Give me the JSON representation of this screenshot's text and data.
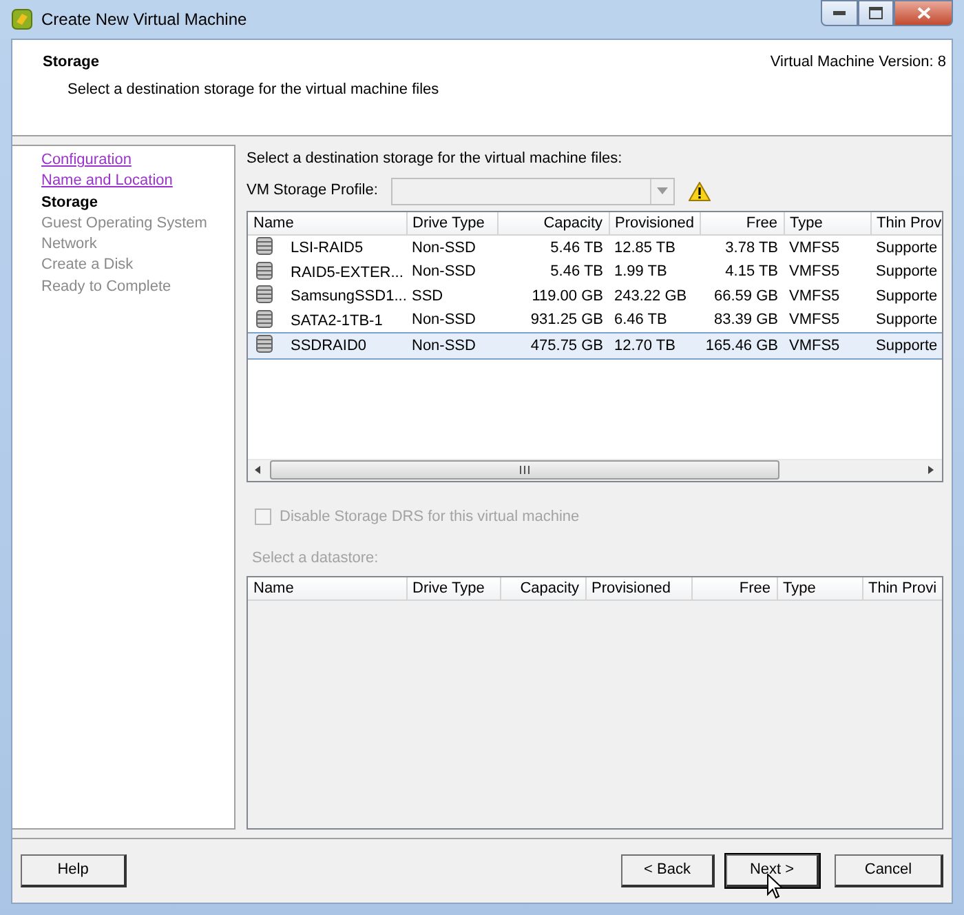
{
  "window": {
    "title": "Create New Virtual Machine"
  },
  "header": {
    "title": "Storage",
    "subtitle": "Select a destination storage for the virtual machine files",
    "version": "Virtual Machine Version: 8"
  },
  "steps": [
    {
      "label": "Configuration",
      "visited": true,
      "current": false
    },
    {
      "label": "Name and Location",
      "visited": true,
      "current": false
    },
    {
      "label": "Storage",
      "visited": false,
      "current": true
    },
    {
      "label": "Guest Operating System",
      "visited": false,
      "current": false
    },
    {
      "label": "Network",
      "visited": false,
      "current": false
    },
    {
      "label": "Create a Disk",
      "visited": false,
      "current": false
    },
    {
      "label": "Ready to Complete",
      "visited": false,
      "current": false
    }
  ],
  "intro": "Select a destination storage for the virtual machine files:",
  "storage_profile": {
    "label": "VM Storage Profile:",
    "disabled": true
  },
  "datastores": {
    "columns": [
      "Name",
      "Drive Type",
      "Capacity",
      "Provisioned",
      "Free",
      "Type",
      "Thin Prov"
    ],
    "rows": [
      {
        "cells": [
          "LSI-RAID5",
          "Non-SSD",
          "5.46 TB",
          "12.85 TB",
          "3.78 TB",
          "VMFS5",
          "Supporte"
        ],
        "selected": false
      },
      {
        "cells": [
          "RAID5-EXTER...",
          "Non-SSD",
          "5.46 TB",
          "1.99 TB",
          "4.15 TB",
          "VMFS5",
          "Supporte"
        ],
        "selected": false
      },
      {
        "cells": [
          "SamsungSSD1...",
          "SSD",
          "119.00 GB",
          "243.22 GB",
          "66.59 GB",
          "VMFS5",
          "Supporte"
        ],
        "selected": false
      },
      {
        "cells": [
          "SATA2-1TB-1",
          "Non-SSD",
          "931.25 GB",
          "6.46 TB",
          "83.39 GB",
          "VMFS5",
          "Supporte"
        ],
        "selected": false
      },
      {
        "cells": [
          "SSDRAID0",
          "Non-SSD",
          "475.75 GB",
          "12.70 TB",
          "165.46 GB",
          "VMFS5",
          "Supporte"
        ],
        "selected": true
      }
    ]
  },
  "drs_checkbox": {
    "label": "Disable Storage DRS for this virtual machine",
    "checked": false,
    "disabled": true
  },
  "datastore_label": {
    "text": "Select a datastore:",
    "disabled": true
  },
  "datastore_table": {
    "columns": [
      "Name",
      "Drive Type",
      "Capacity",
      "Provisioned",
      "Free",
      "Type",
      "Thin Provi"
    ]
  },
  "buttons": [
    {
      "label": "Help",
      "kind": "help"
    },
    {
      "label": "< Back",
      "kind": "nav"
    },
    {
      "label": "Next >",
      "kind": "default"
    },
    {
      "label": "Cancel",
      "kind": "nav"
    }
  ]
}
